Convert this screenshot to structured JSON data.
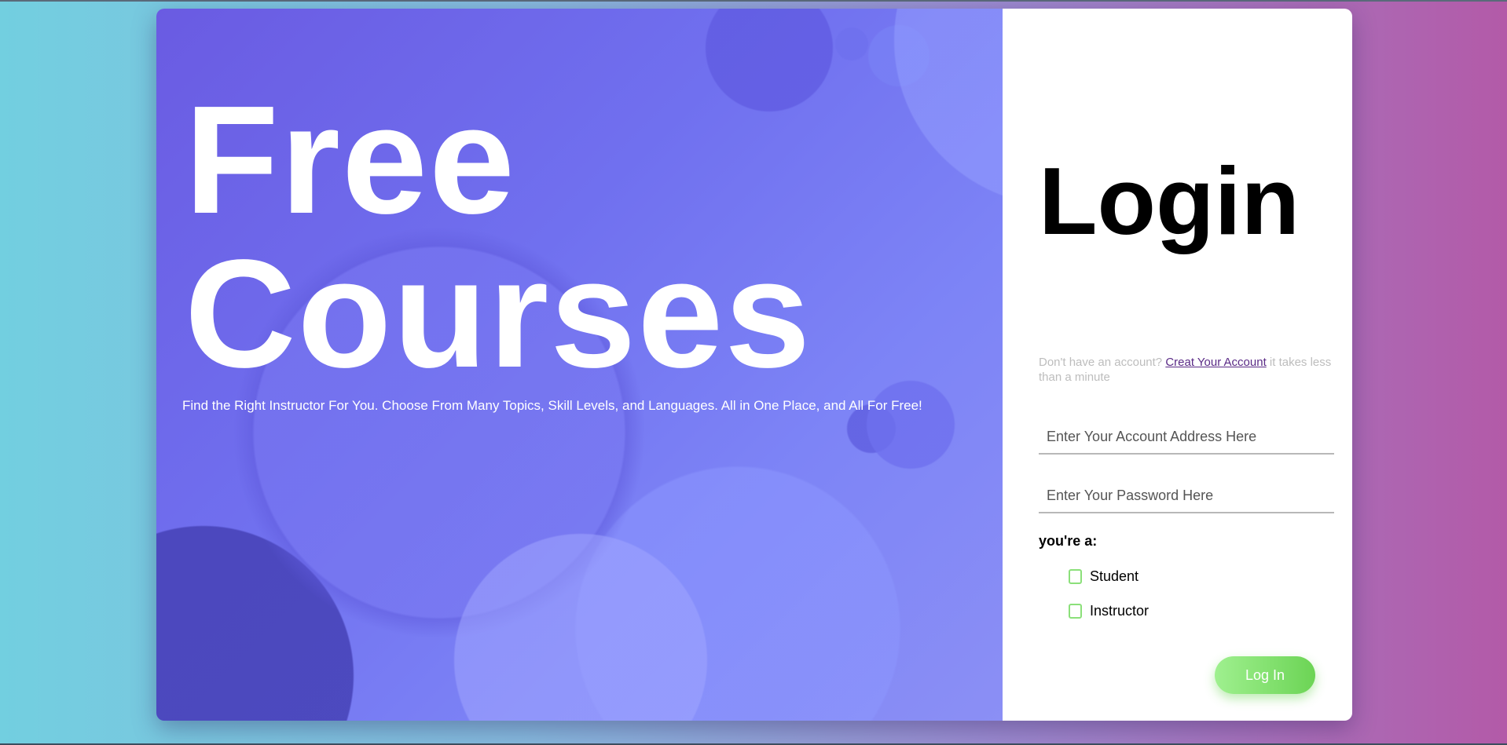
{
  "hero": {
    "title": "Free\nCourses",
    "subtitle": "Find the Right Instructor For You. Choose From Many Topics, Skill Levels, and Languages. All in One Place, and All For Free!"
  },
  "login": {
    "title": "Login",
    "signup_prefix": "Don't have an account? ",
    "signup_link": "Creat Your Account",
    "signup_suffix": " it takes less than a minute",
    "email_placeholder": "Enter Your Account Address Here",
    "password_placeholder": "Enter Your Password Here",
    "role_label": "you're a:",
    "roles": [
      {
        "label": "Student"
      },
      {
        "label": "Instructor"
      }
    ],
    "submit_label": "Log In"
  },
  "colors": {
    "accent_green": "#6cd455",
    "link_purple": "#5a2a86",
    "hero_purple": "#7070ef"
  }
}
